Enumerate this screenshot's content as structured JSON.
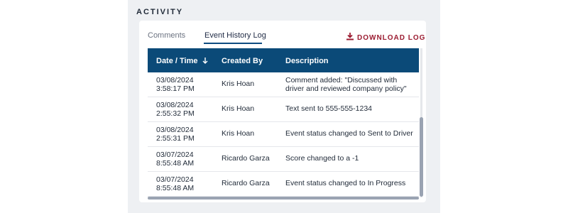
{
  "section": {
    "title": "ACTIVITY"
  },
  "tabs": [
    {
      "label": "Comments",
      "active": false
    },
    {
      "label": "Event History Log",
      "active": true
    }
  ],
  "download": {
    "label": "DOWNLOAD LOG",
    "icon": "download-icon",
    "color": "#9b1c31"
  },
  "table": {
    "header_color": "#0b4a78",
    "columns": [
      "Date / Time",
      "Created By",
      "Description"
    ],
    "sort_icon": "arrow-down-icon",
    "rows": [
      {
        "date": "03/08/2024",
        "time": "3:58:17 PM",
        "by": "Kris Hoan",
        "desc": "Comment added: \"Discussed with driver and reviewed company policy\""
      },
      {
        "date": "03/08/2024",
        "time": "2:55:32 PM",
        "by": "Kris Hoan",
        "desc": "Text sent to 555-555-1234"
      },
      {
        "date": "03/08/2024",
        "time": "2:55:31 PM",
        "by": "Kris Hoan",
        "desc": "Event status changed to Sent to Driver"
      },
      {
        "date": "03/07/2024",
        "time": "8:55:48 AM",
        "by": "Ricardo Garza",
        "desc": "Score changed to a -1"
      },
      {
        "date": "03/07/2024",
        "time": "8:55:48 AM",
        "by": "Ricardo Garza",
        "desc": "Event status changed to In Progress"
      }
    ]
  }
}
